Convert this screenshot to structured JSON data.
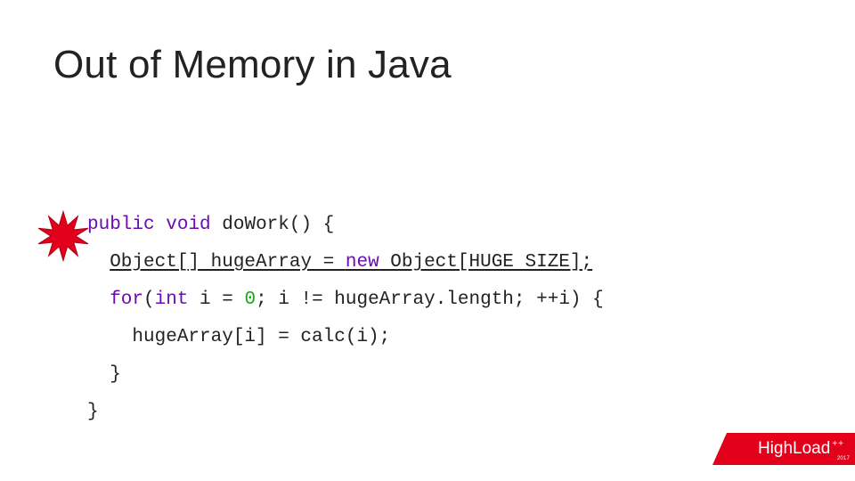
{
  "title": "Out of Memory in Java",
  "code": {
    "line1": {
      "kw_public": "public",
      "kw_void": "void",
      "fn": "doWork() {"
    },
    "line2": {
      "seg1": "Object[] hugeArray = ",
      "kw_new": "new",
      "seg2": " Object[HUGE SIZE];"
    },
    "line3": {
      "kw_for": "for",
      "open": "(",
      "kw_int": "int",
      "seg1": " i = ",
      "zero": "0",
      "seg2": "; i != hugeArray.length; ++i) {"
    },
    "line4": "hugeArray[i] = calc(i);",
    "line5": "}",
    "line6": "}"
  },
  "footer": {
    "brand_a": "High",
    "brand_b": "Load",
    "plus": "++",
    "year": "2017"
  },
  "colors": {
    "keyword": "#6a0dad",
    "number": "#1aa61a",
    "accent_red": "#e3001b"
  }
}
